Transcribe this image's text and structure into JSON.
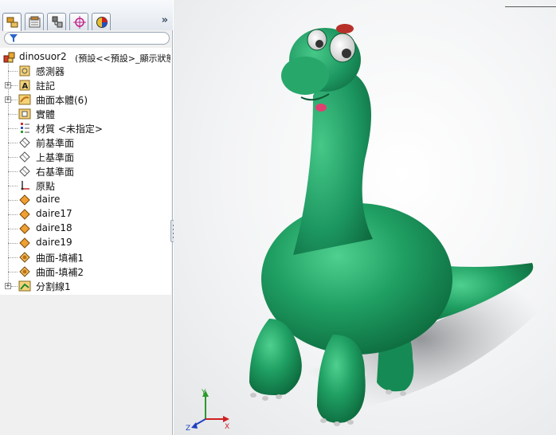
{
  "panel": {
    "tabs": [
      {
        "name": "featuremanager-tab",
        "icon": "feature-tree-icon"
      },
      {
        "name": "propertymanager-tab",
        "icon": "property-manager-icon"
      },
      {
        "name": "configurationmanager-tab",
        "icon": "configuration-icon"
      },
      {
        "name": "dimxpert-tab",
        "icon": "crosshair-icon"
      },
      {
        "name": "display-manager-tab",
        "icon": "appearance-icon"
      }
    ],
    "more_glyph": "»"
  },
  "tree": {
    "root": {
      "name": "dinosuor2",
      "config": "(預設<<預設>_顯示狀態"
    },
    "items": [
      {
        "label": "感測器",
        "icon": "sensor-icon",
        "expandable": false
      },
      {
        "label": "註記",
        "icon": "annotation-icon",
        "expandable": true
      },
      {
        "label": "曲面本體(6)",
        "icon": "surface-bodies-icon",
        "expandable": true
      },
      {
        "label": "實體",
        "icon": "solid-bodies-icon",
        "expandable": false
      },
      {
        "label": "材質 <未指定>",
        "icon": "material-icon",
        "expandable": false
      },
      {
        "label": "前基準面",
        "icon": "plane-icon",
        "expandable": false
      },
      {
        "label": "上基準面",
        "icon": "plane-icon",
        "expandable": false
      },
      {
        "label": "右基準面",
        "icon": "plane-icon",
        "expandable": false
      },
      {
        "label": "原點",
        "icon": "origin-icon",
        "expandable": false
      },
      {
        "label": "daire",
        "icon": "sketch-icon",
        "expandable": false
      },
      {
        "label": "daire17",
        "icon": "sketch-icon",
        "expandable": false
      },
      {
        "label": "daire18",
        "icon": "sketch-icon",
        "expandable": false
      },
      {
        "label": "daire19",
        "icon": "sketch-icon",
        "expandable": false
      },
      {
        "label": "曲面-填補1",
        "icon": "fill-surface-icon",
        "expandable": false
      },
      {
        "label": "曲面-填補2",
        "icon": "fill-surface-icon",
        "expandable": false
      },
      {
        "label": "分割線1",
        "icon": "split-line-icon",
        "expandable": true
      }
    ]
  },
  "viewport": {
    "model": "dinosaur-model",
    "model_color": "#1f9e62",
    "triad": {
      "x": "X",
      "y": "Y",
      "z": "Z"
    }
  }
}
